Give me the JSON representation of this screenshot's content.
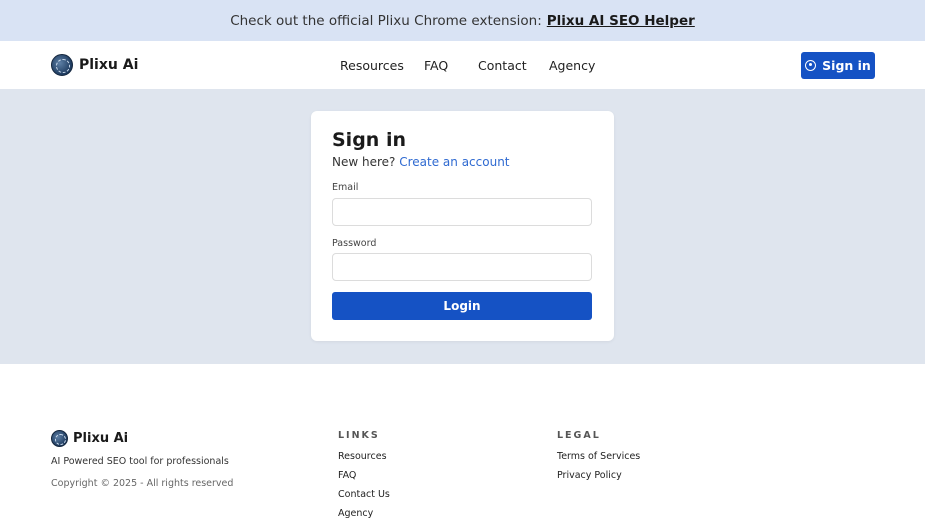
{
  "banner": {
    "text": "Check out the official Plixu Chrome extension:",
    "link": "Plixu AI SEO Helper"
  },
  "brand": {
    "name": "Plixu Ai"
  },
  "nav": {
    "items": [
      "Resources",
      "FAQ",
      "Contact",
      "Agency"
    ],
    "signin_label": "Sign in"
  },
  "login": {
    "title": "Sign in",
    "new_here": "New here?",
    "create_account": "Create an account",
    "email_label": "Email",
    "email_value": "",
    "password_label": "Password",
    "password_value": "",
    "button": "Login"
  },
  "footer": {
    "brand": "Plixu Ai",
    "tagline": "AI Powered SEO tool for professionals",
    "copyright": "Copyright © 2025 - All rights reserved",
    "links_heading": "LINKS",
    "links": [
      "Resources",
      "FAQ",
      "Contact Us",
      "Agency"
    ],
    "legal_heading": "LEGAL",
    "legal": [
      "Terms of Services",
      "Privacy Policy"
    ]
  },
  "colors": {
    "primary": "#1552c4",
    "banner_bg": "#d9e3f4",
    "main_bg": "#dfe5ee",
    "link": "#2f6ad1"
  },
  "icons": {
    "logo": "brain-logo-icon",
    "signin": "user-circle-icon"
  }
}
